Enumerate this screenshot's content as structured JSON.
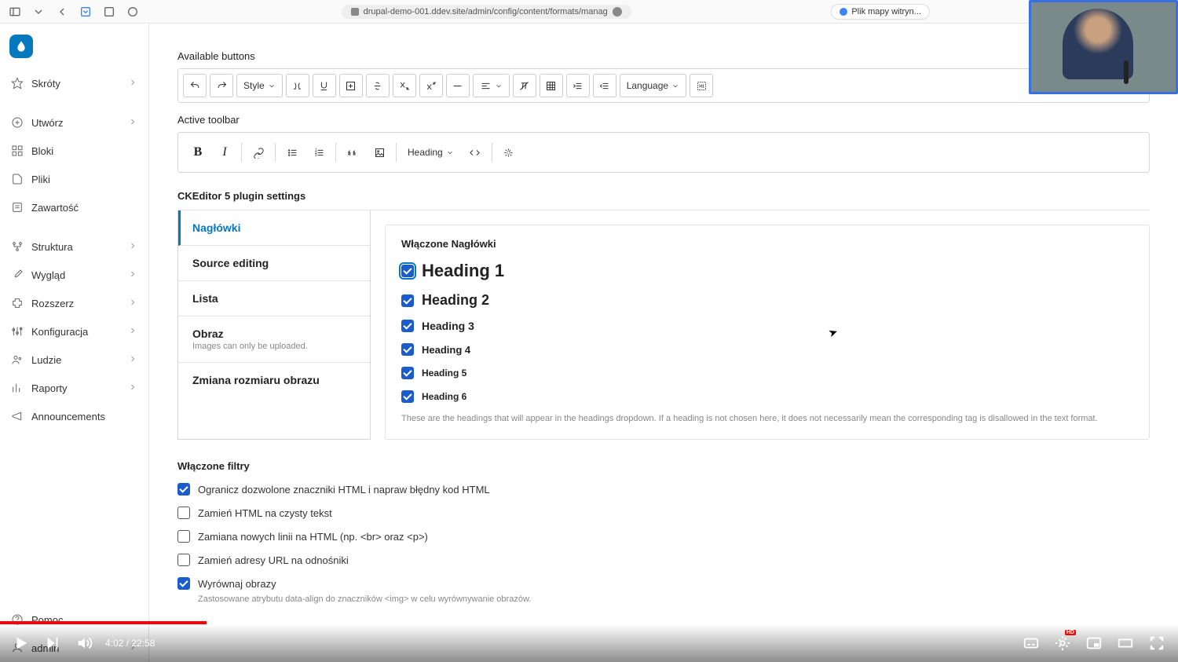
{
  "browser": {
    "url": "drupal-demo-001.ddev.site/admin/config/content/formats/manag",
    "tab_label": "Plik mapy witryn..."
  },
  "sidebar": {
    "items": [
      {
        "label": "Skróty",
        "icon": "star",
        "chevron": true
      },
      {
        "label": "Utwórz",
        "icon": "plus-circle",
        "chevron": true
      },
      {
        "label": "Bloki",
        "icon": "blocks",
        "chevron": false
      },
      {
        "label": "Pliki",
        "icon": "file",
        "chevron": false
      },
      {
        "label": "Zawartość",
        "icon": "content",
        "chevron": false
      },
      {
        "label": "Struktura",
        "icon": "structure",
        "chevron": true
      },
      {
        "label": "Wygląd",
        "icon": "brush",
        "chevron": true
      },
      {
        "label": "Rozszerz",
        "icon": "puzzle",
        "chevron": true
      },
      {
        "label": "Konfiguracja",
        "icon": "sliders",
        "chevron": true
      },
      {
        "label": "Ludzie",
        "icon": "people",
        "chevron": true
      },
      {
        "label": "Raporty",
        "icon": "report",
        "chevron": true
      },
      {
        "label": "Announcements",
        "icon": "megaphone",
        "chevron": false
      }
    ],
    "bottom": [
      {
        "label": "Pomoc",
        "icon": "help"
      },
      {
        "label": "admin",
        "icon": "user",
        "chevron": true
      }
    ]
  },
  "editor": {
    "available_label": "Available buttons",
    "active_label": "Active toolbar",
    "style_label": "Style",
    "language_label": "Language",
    "heading_label": "Heading"
  },
  "plugin": {
    "section_title": "CKEditor 5 plugin settings",
    "tabs": [
      {
        "title": "Nagłówki"
      },
      {
        "title": "Source editing"
      },
      {
        "title": "Lista"
      },
      {
        "title": "Obraz",
        "desc": "Images can only be uploaded."
      },
      {
        "title": "Zmiana rozmiaru obrazu"
      }
    ],
    "content_title": "Włączone Nagłówki",
    "headings": [
      {
        "label": "Heading 1",
        "checked": true,
        "level": 1,
        "focus": true
      },
      {
        "label": "Heading 2",
        "checked": true,
        "level": 2
      },
      {
        "label": "Heading 3",
        "checked": true,
        "level": 3
      },
      {
        "label": "Heading 4",
        "checked": true,
        "level": 4
      },
      {
        "label": "Heading 5",
        "checked": true,
        "level": 5
      },
      {
        "label": "Heading 6",
        "checked": true,
        "level": 6
      }
    ],
    "note": "These are the headings that will appear in the headings dropdown. If a heading is not chosen here, it does not necessarily mean the corresponding tag is disallowed in the text format."
  },
  "filters": {
    "title": "Włączone filtry",
    "items": [
      {
        "label": "Ogranicz dozwolone znaczniki HTML i napraw błędny kod HTML",
        "checked": true
      },
      {
        "label": "Zamień HTML na czysty tekst",
        "checked": false
      },
      {
        "label": "Zamiana nowych linii na HTML (np. <br> oraz <p>)",
        "checked": false
      },
      {
        "label": "Zamień adresy URL na odnośniki",
        "checked": false
      },
      {
        "label": "Wyrównaj obrazy",
        "checked": true,
        "desc": "Zastosowane atrybutu data-align do znaczników <img> w celu wyrównywanie obrazów."
      }
    ]
  },
  "video": {
    "time": "4:02 / 22:58",
    "hd": "HD"
  }
}
